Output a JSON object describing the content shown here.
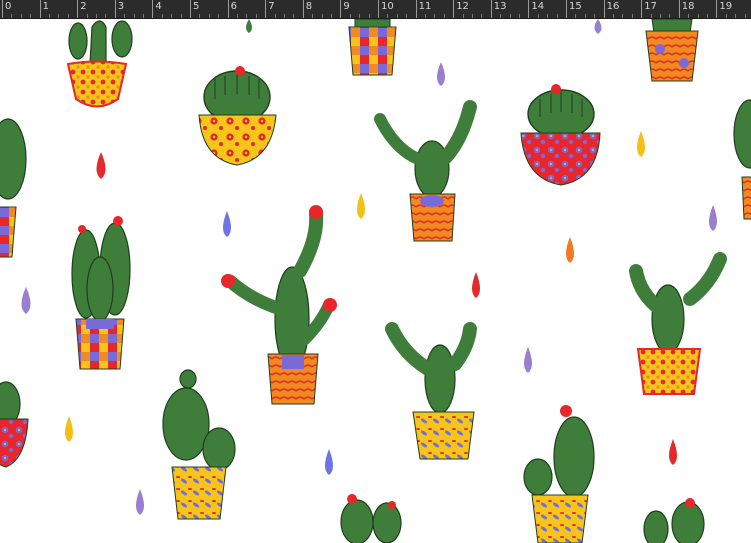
{
  "ruler": {
    "labels": [
      "0",
      "1",
      "2",
      "3",
      "4",
      "5",
      "6",
      "7",
      "8",
      "9",
      "10",
      "11",
      "12",
      "13",
      "14",
      "15",
      "16",
      "17",
      "18",
      "19"
    ]
  },
  "canvas": {
    "background_color": "#ffffff",
    "palette": {
      "cactus_green": "#3f7d3a",
      "cactus_dark": "#1f3f1c",
      "flower_red": "#e8262b",
      "pot_yellow": "#f5c51b",
      "pot_orange": "#f08a21",
      "pot_purple": "#7a6ad8",
      "drop_purple": "#9a7fd1",
      "drop_blue": "#6f73e6",
      "drop_red": "#e52a2d",
      "drop_yellow": "#f3c017",
      "drop_orange": "#f07a25"
    }
  }
}
